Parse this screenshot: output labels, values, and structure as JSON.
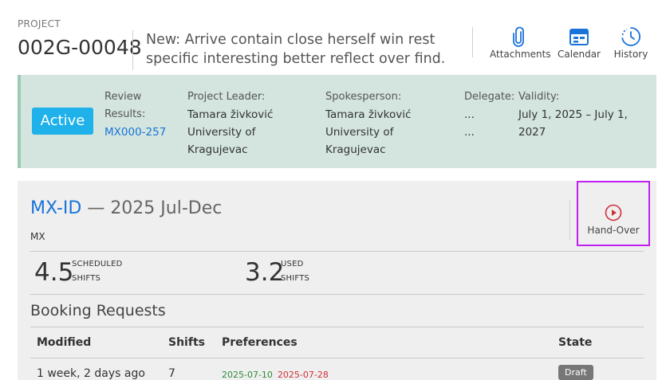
{
  "header": {
    "project_label": "PROJECT",
    "project_id": "002G-00048",
    "title": "New: Arrive contain close herself win rest specific interesting better reflect over find.",
    "actions": [
      {
        "label": "Attachments",
        "icon": "paperclip-icon"
      },
      {
        "label": "Calendar",
        "icon": "calendar-icon"
      },
      {
        "label": "History",
        "icon": "history-icon"
      }
    ]
  },
  "status": {
    "badge": "Active",
    "review_label_1": "Review",
    "review_label_2": "Results:",
    "review_link": "MX000-257",
    "leader_label": "Project Leader:",
    "leader_name": "Tamara živković",
    "leader_org_1": "University of",
    "leader_org_2": "Kragujevac",
    "spokes_label": "Spokesperson:",
    "spokes_name": "Tamara živković",
    "spokes_org_1": "University of",
    "spokes_org_2": "Kragujevac",
    "delegate_label": "Delegate:",
    "delegate_1": "...",
    "delegate_2": "...",
    "validity_label": "Validity:",
    "validity_1": "July 1, 2025 – July 1,",
    "validity_2": "2027"
  },
  "card": {
    "title_link": "MX-ID",
    "title_rest": " — 2025 Jul-Dec",
    "subtitle": "MX",
    "hand_over_label": "Hand-Over",
    "stats": [
      {
        "value": "4.5",
        "label_1": "SCHEDULED",
        "label_2": "SHIFTS"
      },
      {
        "value": "3.2",
        "label_1": "USED",
        "label_2": "SHIFTS"
      }
    ],
    "section_title": "Booking Requests",
    "columns": [
      "Modified",
      "Shifts",
      "Preferences",
      "State"
    ],
    "rows": [
      {
        "modified": "1 week, 2 days ago",
        "shifts": "7",
        "pref_start": "2025-07-10",
        "pref_end": "2025-07-28",
        "state": "Draft"
      }
    ]
  },
  "colors": {
    "accent": "#1a73d9",
    "badge_active": "#1fb1ea",
    "status_bg": "#d3e5de",
    "highlight_border": "#c020f0",
    "pref_start": "#2e8b3a",
    "pref_end": "#d0303a"
  }
}
